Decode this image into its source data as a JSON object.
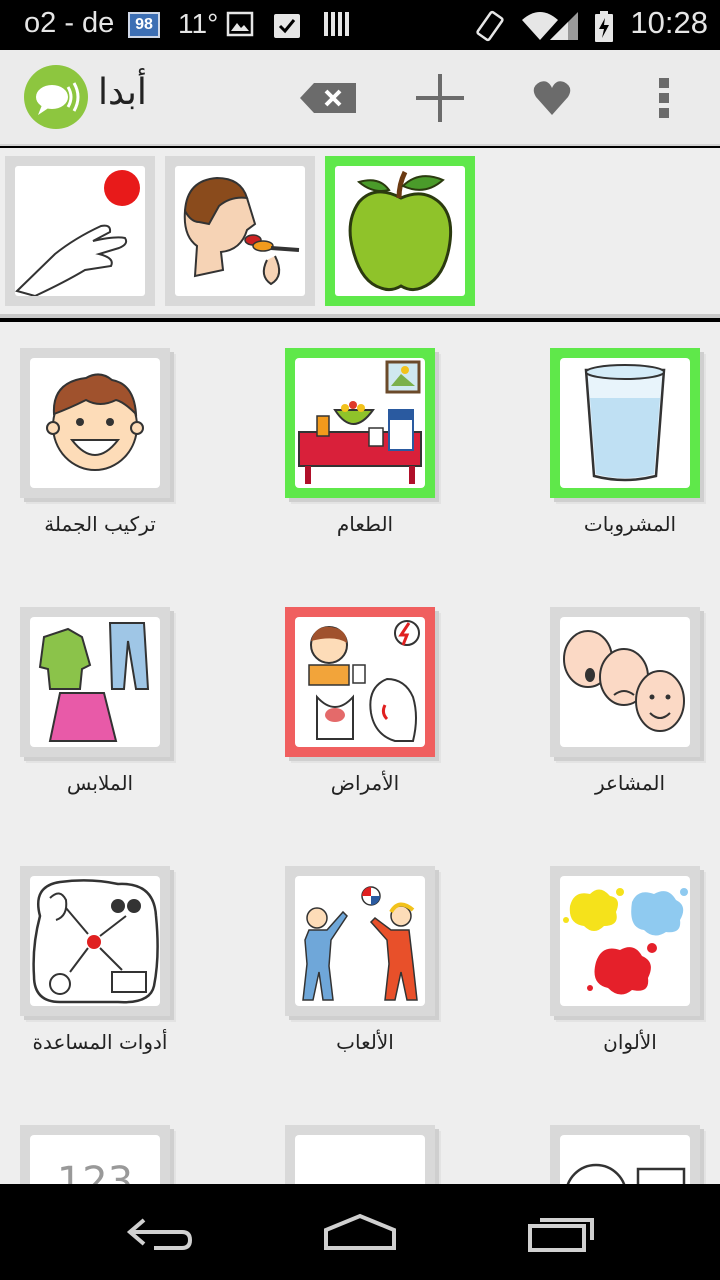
{
  "status_bar": {
    "carrier": "o2 - de",
    "badge": "98",
    "temperature": "11°",
    "time": "10:28"
  },
  "action_bar": {
    "title": "أبدا",
    "icons": [
      "app-logo",
      "backspace-icon",
      "add-icon",
      "favorite-icon",
      "overflow-menu-icon"
    ]
  },
  "sentence_strip": {
    "items": [
      {
        "icon": "give-hand-ball",
        "selected": false
      },
      {
        "icon": "eat-spoon",
        "selected": false
      },
      {
        "icon": "apple",
        "selected": true
      }
    ]
  },
  "grid": {
    "tiles": [
      {
        "label": "تركيب الجملة",
        "icon": "boy-face",
        "border": "none"
      },
      {
        "label": "الطعام",
        "icon": "food-table",
        "border": "green"
      },
      {
        "label": "المشروبات",
        "icon": "glass-water",
        "border": "green"
      },
      {
        "label": "الملابس",
        "icon": "clothes",
        "border": "none"
      },
      {
        "label": "الأمراض",
        "icon": "illness",
        "border": "red"
      },
      {
        "label": "المشاعر",
        "icon": "feelings-faces",
        "border": "none"
      },
      {
        "label": "أدوات المساعدة",
        "icon": "assistive-tools",
        "border": "none"
      },
      {
        "label": "الألعاب",
        "icon": "kids-playing-ball",
        "border": "none"
      },
      {
        "label": "الألوان",
        "icon": "color-splashes",
        "border": "none"
      },
      {
        "label": "",
        "icon": "numbers",
        "border": "none"
      },
      {
        "label": "",
        "icon": "blank",
        "border": "none"
      },
      {
        "label": "",
        "icon": "shapes",
        "border": "none"
      }
    ]
  },
  "colors": {
    "selected_border": "#5fe84a",
    "alert_border": "#f05f5f",
    "logo_green": "#8dc63f"
  }
}
